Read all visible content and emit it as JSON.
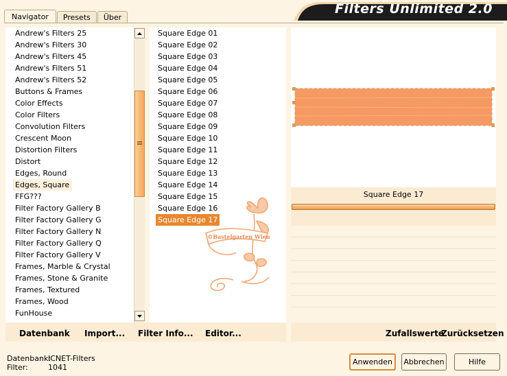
{
  "tabs": [
    {
      "label": "Navigator",
      "active": true
    },
    {
      "label": "Presets",
      "active": false
    },
    {
      "label": "Über",
      "active": false
    }
  ],
  "app_title": "Filters Unlimited 2.0",
  "categories": [
    "Andrew's Filters 25",
    "Andrew's Filters 30",
    "Andrew's Filters 45",
    "Andrew's Filters 51",
    "Andrew's Filters 52",
    "Buttons & Frames",
    "Color Effects",
    "Color Filters",
    "Convolution Filters",
    "Crescent Moon",
    "Distortion Filters",
    "Distort",
    "Edges, Round",
    "Edges, Square",
    "FFG???",
    "Filter Factory Gallery B",
    "Filter Factory Gallery G",
    "Filter Factory Gallery N",
    "Filter Factory Gallery Q",
    "Filter Factory Gallery V",
    "Frames, Marble & Crystal",
    "Frames, Stone & Granite",
    "Frames, Textured",
    "Frames, Wood",
    "FunHouse"
  ],
  "selected_category": "Edges, Square",
  "filters": [
    "Square Edge 01",
    "Square Edge 02",
    "Square Edge 03",
    "Square Edge 04",
    "Square Edge 05",
    "Square Edge 06",
    "Square Edge 07",
    "Square Edge 08",
    "Square Edge 09",
    "Square Edge 10",
    "Square Edge 11",
    "Square Edge 12",
    "Square Edge 13",
    "Square Edge 14",
    "Square Edge 15",
    "Square Edge 16",
    "Square Edge 17"
  ],
  "selected_filter": "Square Edge 17",
  "watermark": "©Bastelgarten Wien",
  "preview": {
    "filter_label": "Square Edge 17",
    "strip_color": "#f59a62"
  },
  "links_left": {
    "database": "Datenbank",
    "import": "Import...",
    "filter_info": "Filter Info...",
    "editor": "Editor..."
  },
  "links_right": {
    "random": "Zufallswerte",
    "reset": "Zurücksetzen"
  },
  "status": {
    "database_label": "Datenbank:",
    "database_value": "ICNET-Filters",
    "filter_label": "Filter:",
    "filter_value": "1041"
  },
  "buttons": {
    "apply": "Anwenden",
    "cancel": "Abbrechen",
    "help": "Hilfe"
  },
  "colors": {
    "accent": "#e8872f",
    "background": "#fdf4e3",
    "banner": "#1c1c1c"
  }
}
